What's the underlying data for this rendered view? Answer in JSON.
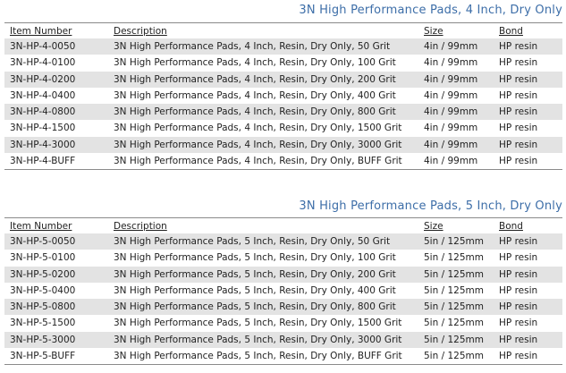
{
  "headers": {
    "item_number": "Item Number",
    "description": "Description",
    "size": "Size",
    "bond": "Bond"
  },
  "sections": [
    {
      "title": "3N High Performance Pads, 4 Inch, Dry Only",
      "rows": [
        {
          "item": "3N-HP-4-0050",
          "description": "3N High Performance Pads, 4 Inch, Resin, Dry Only, 50 Grit",
          "size": "4in / 99mm",
          "bond": "HP resin"
        },
        {
          "item": "3N-HP-4-0100",
          "description": "3N High Performance Pads, 4 Inch, Resin, Dry Only, 100 Grit",
          "size": "4in / 99mm",
          "bond": "HP resin"
        },
        {
          "item": "3N-HP-4-0200",
          "description": "3N High Performance Pads, 4 Inch, Resin, Dry Only, 200 Grit",
          "size": "4in / 99mm",
          "bond": "HP resin"
        },
        {
          "item": "3N-HP-4-0400",
          "description": "3N High Performance Pads, 4 Inch, Resin, Dry Only, 400 Grit",
          "size": "4in / 99mm",
          "bond": "HP resin"
        },
        {
          "item": "3N-HP-4-0800",
          "description": "3N High Performance Pads, 4 Inch, Resin, Dry Only, 800 Grit",
          "size": "4in / 99mm",
          "bond": "HP resin"
        },
        {
          "item": "3N-HP-4-1500",
          "description": "3N High Performance Pads, 4 Inch, Resin, Dry Only, 1500 Grit",
          "size": "4in / 99mm",
          "bond": "HP resin"
        },
        {
          "item": "3N-HP-4-3000",
          "description": "3N High Performance Pads, 4 Inch, Resin, Dry Only, 3000 Grit",
          "size": "4in / 99mm",
          "bond": "HP resin"
        },
        {
          "item": "3N-HP-4-BUFF",
          "description": "3N High Performance Pads, 4 Inch, Resin, Dry Only, BUFF Grit",
          "size": "4in / 99mm",
          "bond": "HP resin"
        }
      ]
    },
    {
      "title": "3N High Performance Pads, 5 Inch, Dry Only",
      "rows": [
        {
          "item": "3N-HP-5-0050",
          "description": "3N High Performance Pads, 5 Inch, Resin, Dry Only, 50 Grit",
          "size": "5in / 125mm",
          "bond": "HP resin"
        },
        {
          "item": "3N-HP-5-0100",
          "description": "3N High Performance Pads, 5 Inch, Resin, Dry Only, 100 Grit",
          "size": "5in / 125mm",
          "bond": "HP resin"
        },
        {
          "item": "3N-HP-5-0200",
          "description": "3N High Performance Pads, 5 Inch, Resin, Dry Only, 200 Grit",
          "size": "5in / 125mm",
          "bond": "HP resin"
        },
        {
          "item": "3N-HP-5-0400",
          "description": "3N High Performance Pads, 5 Inch, Resin, Dry Only, 400 Grit",
          "size": "5in / 125mm",
          "bond": "HP resin"
        },
        {
          "item": "3N-HP-5-0800",
          "description": "3N High Performance Pads, 5 Inch, Resin, Dry Only, 800 Grit",
          "size": "5in / 125mm",
          "bond": "HP resin"
        },
        {
          "item": "3N-HP-5-1500",
          "description": "3N High Performance Pads, 5 Inch, Resin, Dry Only, 1500 Grit",
          "size": "5in / 125mm",
          "bond": "HP resin"
        },
        {
          "item": "3N-HP-5-3000",
          "description": "3N High Performance Pads, 5 Inch, Resin, Dry Only, 3000 Grit",
          "size": "5in / 125mm",
          "bond": "HP resin"
        },
        {
          "item": "3N-HP-5-BUFF",
          "description": "3N High Performance Pads, 5 Inch, Resin, Dry Only, BUFF Grit",
          "size": "5in / 125mm",
          "bond": "HP resin"
        }
      ]
    }
  ]
}
